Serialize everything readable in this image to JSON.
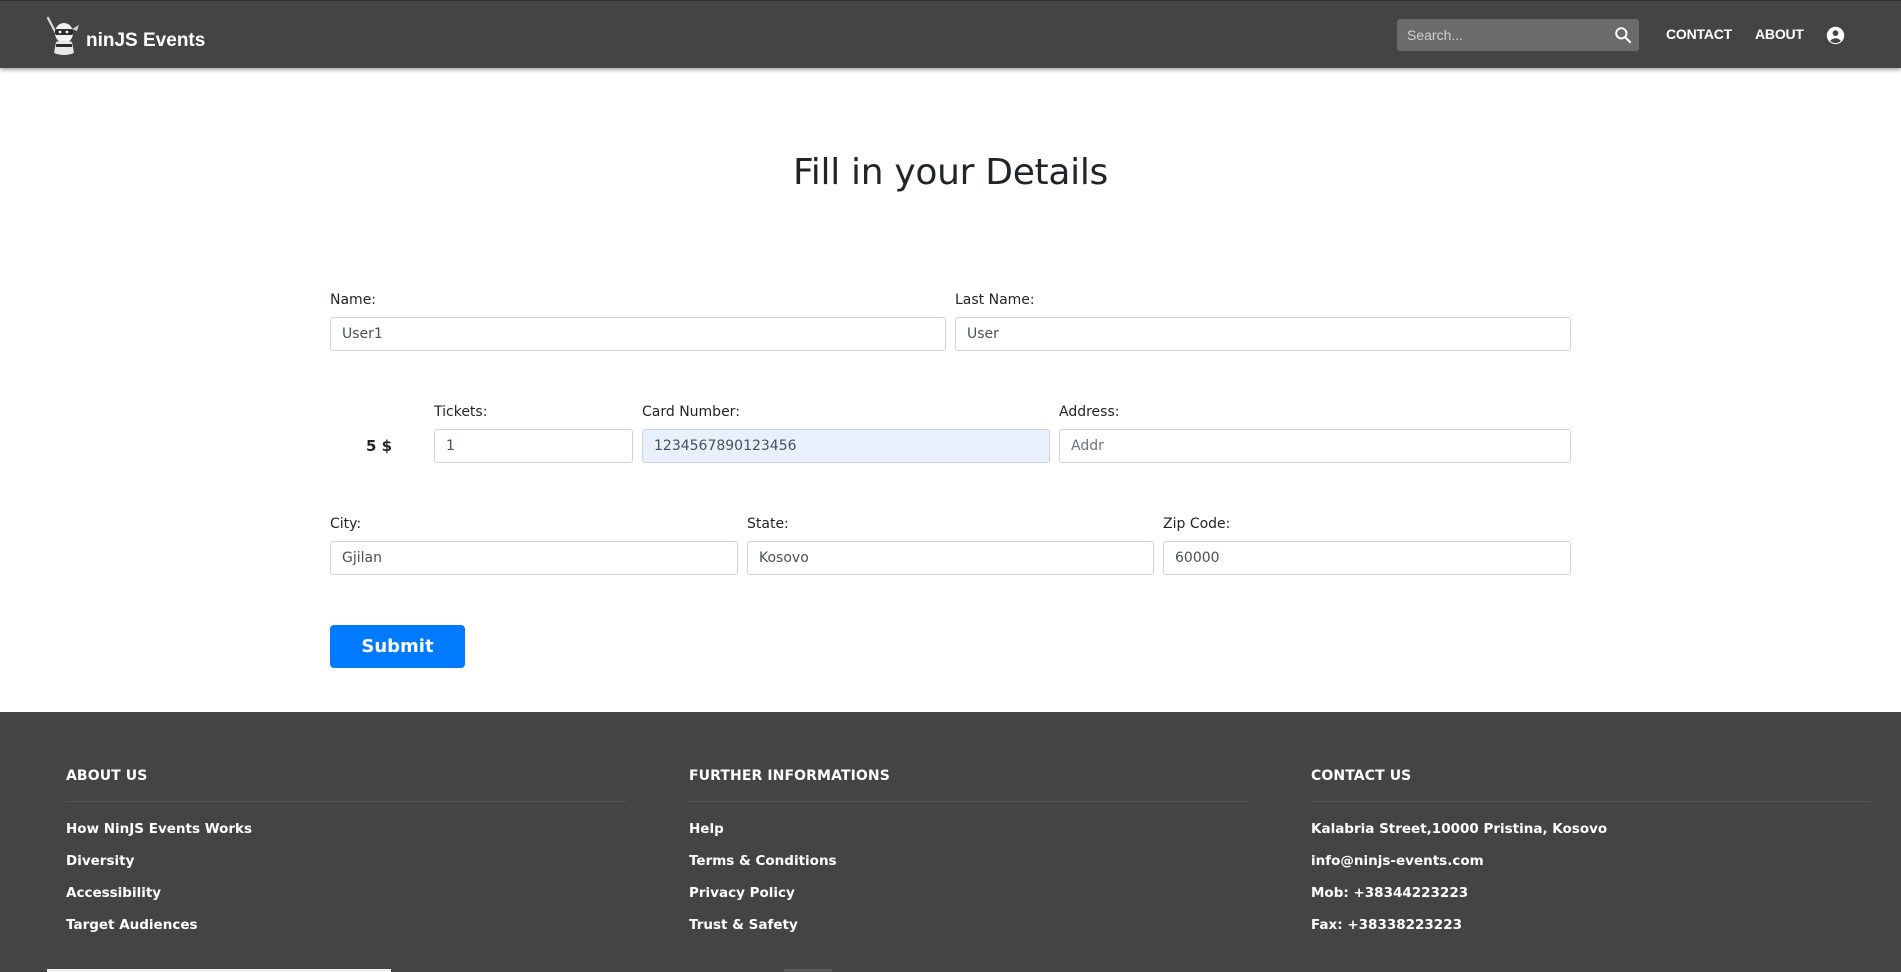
{
  "navbar": {
    "brand": "ninJS Events",
    "search_placeholder": "Search...",
    "links": {
      "contact": "CONTACT",
      "about": "ABOUT"
    }
  },
  "main": {
    "title": "Fill in your Details",
    "price": "5 $",
    "fields": {
      "name": {
        "label": "Name:",
        "value": "User1"
      },
      "last_name": {
        "label": "Last Name:",
        "value": "User"
      },
      "tickets": {
        "label": "Tickets:",
        "value": "1"
      },
      "card_number": {
        "label": "Card Number:",
        "value": "1234567890123456"
      },
      "address": {
        "label": "Address:",
        "placeholder": "Addr",
        "value": ""
      },
      "city": {
        "label": "City:",
        "value": "Gjilan"
      },
      "state": {
        "label": "State:",
        "value": "Kosovo"
      },
      "zip": {
        "label": "Zip Code:",
        "value": "60000"
      }
    },
    "submit_label": "Submit"
  },
  "footer": {
    "about": {
      "heading": "ABOUT US",
      "items": [
        "How NinJS Events Works",
        "Diversity",
        "Accessibility",
        "Target Audiences"
      ]
    },
    "further": {
      "heading": "FURTHER INFORMATIONS",
      "items": [
        "Help",
        "Terms & Conditions",
        "Privacy Policy",
        "Trust & Safety"
      ]
    },
    "contact": {
      "heading": "CONTACT US",
      "items": [
        "Kalabria Street,10000 Pristina, Kosovo",
        "info@ninjs-events.com",
        "Mob: +38344223223",
        "Fax: +38338223223"
      ]
    }
  },
  "colors": {
    "navbar_bg": "#444444",
    "accent": "#007bff",
    "autofill_bg": "#e8f0fe"
  },
  "icons": [
    "ninja-logo-icon",
    "search-icon",
    "user-account-icon"
  ]
}
